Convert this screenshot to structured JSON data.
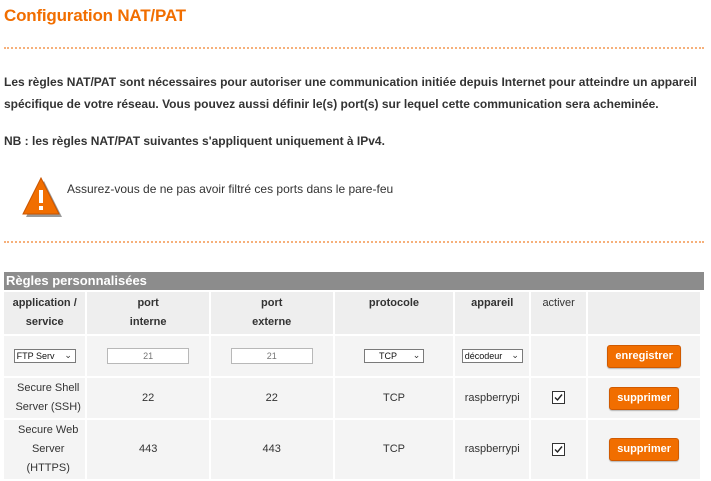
{
  "page": {
    "title": "Configuration NAT/PAT",
    "intro": "Les règles NAT/PAT sont nécessaires pour autoriser une communication initiée depuis Internet pour atteindre un appareil spécifique de votre réseau. Vous pouvez aussi définir le(s) port(s) sur lequel cette communication sera acheminée.",
    "nb": "NB : les règles NAT/PAT suivantes s'appliquent uniquement à IPv4.",
    "warning": "Assurez-vous de ne pas avoir filtré ces ports dans le pare-feu"
  },
  "colors": {
    "accent": "#f16e00",
    "header_bar": "#8c8c8c"
  },
  "table": {
    "title": "Règles personnalisées",
    "headers": {
      "application_line1": "application /",
      "application_line2": "service",
      "internal_line1": "port",
      "internal_line2": "interne",
      "external_line1": "port",
      "external_line2": "externe",
      "protocol": "protocole",
      "device": "appareil",
      "activate": "activer"
    },
    "new_rule": {
      "application": "FTP Serv",
      "internal_port_placeholder": "21",
      "external_port_placeholder": "21",
      "protocol": "TCP",
      "device": "décodeur",
      "save_label": "enregistrer"
    },
    "rows": [
      {
        "application_line1": "Secure Shell",
        "application_line2": "Server (SSH)",
        "internal_port": "22",
        "external_port": "22",
        "protocol": "TCP",
        "device": "raspberrypi",
        "active": true,
        "delete_label": "supprimer"
      },
      {
        "application_line1": "Secure Web",
        "application_line2": "Server (HTTPS)",
        "internal_port": "443",
        "external_port": "443",
        "protocol": "TCP",
        "device": "raspberrypi",
        "active": true,
        "delete_label": "supprimer"
      }
    ]
  }
}
